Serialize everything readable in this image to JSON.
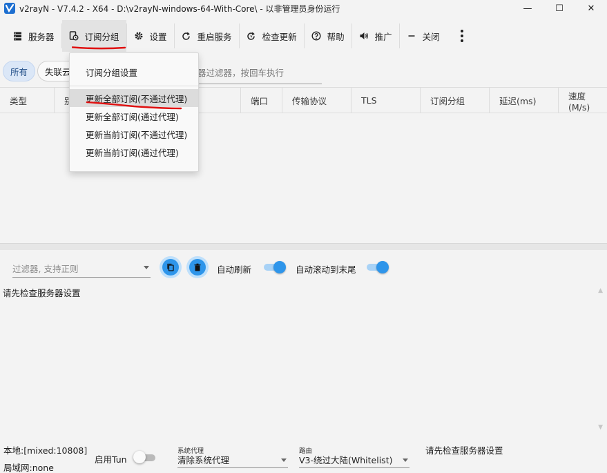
{
  "window": {
    "title": "v2rayN - V7.4.2 - X64 - D:\\v2rayN-windows-64-With-Core\\ - 以非管理员身份运行",
    "minimize": "—",
    "maximize": "☐",
    "close": "✕"
  },
  "toolbar": {
    "servers": "服务器",
    "subscription_group": "订阅分组",
    "settings": "设置",
    "restart_service": "重启服务",
    "check_update": "检查更新",
    "help": "帮助",
    "promotion": "推广",
    "close": "关闭"
  },
  "chips": {
    "all": "所有",
    "second": "失联云"
  },
  "server_filter": {
    "placeholder": "器过滤器，按回车执行"
  },
  "table": {
    "headers": [
      "类型",
      "别",
      "端口",
      "传输协议",
      "TLS",
      "订阅分组",
      "延迟(ms)",
      "速度(M/s)"
    ]
  },
  "subscription_menu": {
    "items": [
      "订阅分组设置",
      "更新全部订阅(不通过代理)",
      "更新全部订阅(通过代理)",
      "更新当前订阅(不通过代理)",
      "更新当前订阅(通过代理)"
    ]
  },
  "log": {
    "filter_placeholder": "过滤器, 支持正则",
    "auto_refresh": "自动刷新",
    "auto_scroll": "自动滚动到末尾",
    "message": "请先检查服务器设置"
  },
  "status": {
    "local": "本地:[mixed:10808]",
    "lan": "局域网:none",
    "tun_label": "启用Tun",
    "system_proxy_caption": "系统代理",
    "system_proxy_value": "清除系统代理",
    "routing_caption": "路由",
    "routing_value": "V3-绕过大陆(Whitelist)",
    "message": "请先检查服务器设置"
  },
  "colors": {
    "accent": "#2e95ea",
    "annotation_red": "#e01010"
  }
}
